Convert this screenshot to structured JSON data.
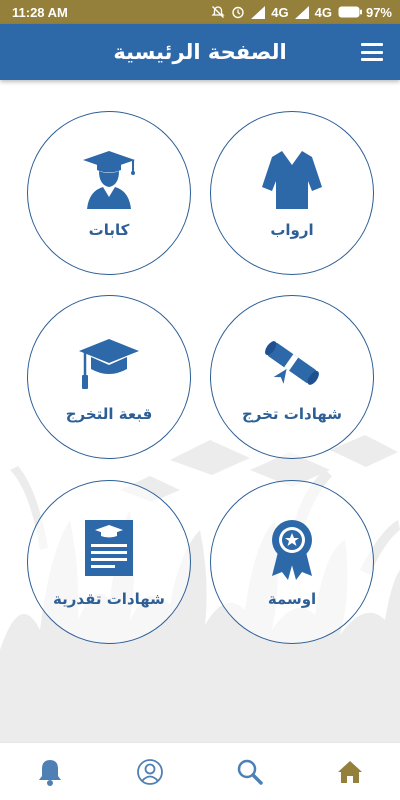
{
  "status_bar": {
    "time": "11:28 AM",
    "network_1": "4G",
    "network_2": "4G",
    "battery": "97%",
    "icons": [
      "mute-icon",
      "alarm-icon",
      "signal-icon",
      "signal-icon",
      "battery-icon"
    ]
  },
  "app_bar": {
    "title": "الصفحة الرئيسية",
    "menu_icon": "hamburger-menu-icon"
  },
  "tiles": [
    {
      "label": "كابات",
      "icon": "graduate-cap-person-icon"
    },
    {
      "label": "ارواب",
      "icon": "graduation-gown-icon"
    },
    {
      "label": "قبعة التخرج",
      "icon": "mortarboard-icon"
    },
    {
      "label": "شهادات تخرج",
      "icon": "diploma-scroll-icon"
    },
    {
      "label": "شهادات تقدرية",
      "icon": "certificate-icon"
    },
    {
      "label": "اوسمة",
      "icon": "award-ribbon-icon"
    }
  ],
  "bottom_nav": [
    {
      "icon": "bell-icon"
    },
    {
      "icon": "user-profile-icon"
    },
    {
      "icon": "search-icon"
    },
    {
      "icon": "home-icon",
      "active": true
    }
  ],
  "colors": {
    "status_bar": "#94803a",
    "app_bar": "#2d68a9",
    "tile_accent": "#2d5f96",
    "nav_icon": "#4f80b5",
    "nav_active": "#94803a",
    "background_art": "#ececec"
  }
}
